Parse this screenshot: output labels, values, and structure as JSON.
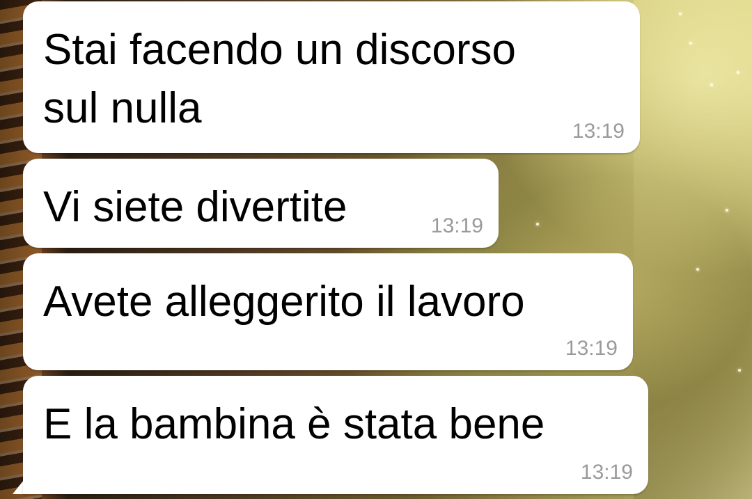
{
  "chat": {
    "messages": [
      {
        "text": "Stai facendo un discorso\nsul nulla",
        "time": "13:19"
      },
      {
        "text": "Vi siete divertite",
        "time": "13:19"
      },
      {
        "text": "Avete alleggerito il lavoro",
        "time": "13:19"
      },
      {
        "text": "E la bambina è stata bene",
        "time": "13:19"
      }
    ]
  },
  "colors": {
    "bubble": "#ffffff",
    "message_text": "#000000",
    "timestamp": "#9a9a9a"
  }
}
